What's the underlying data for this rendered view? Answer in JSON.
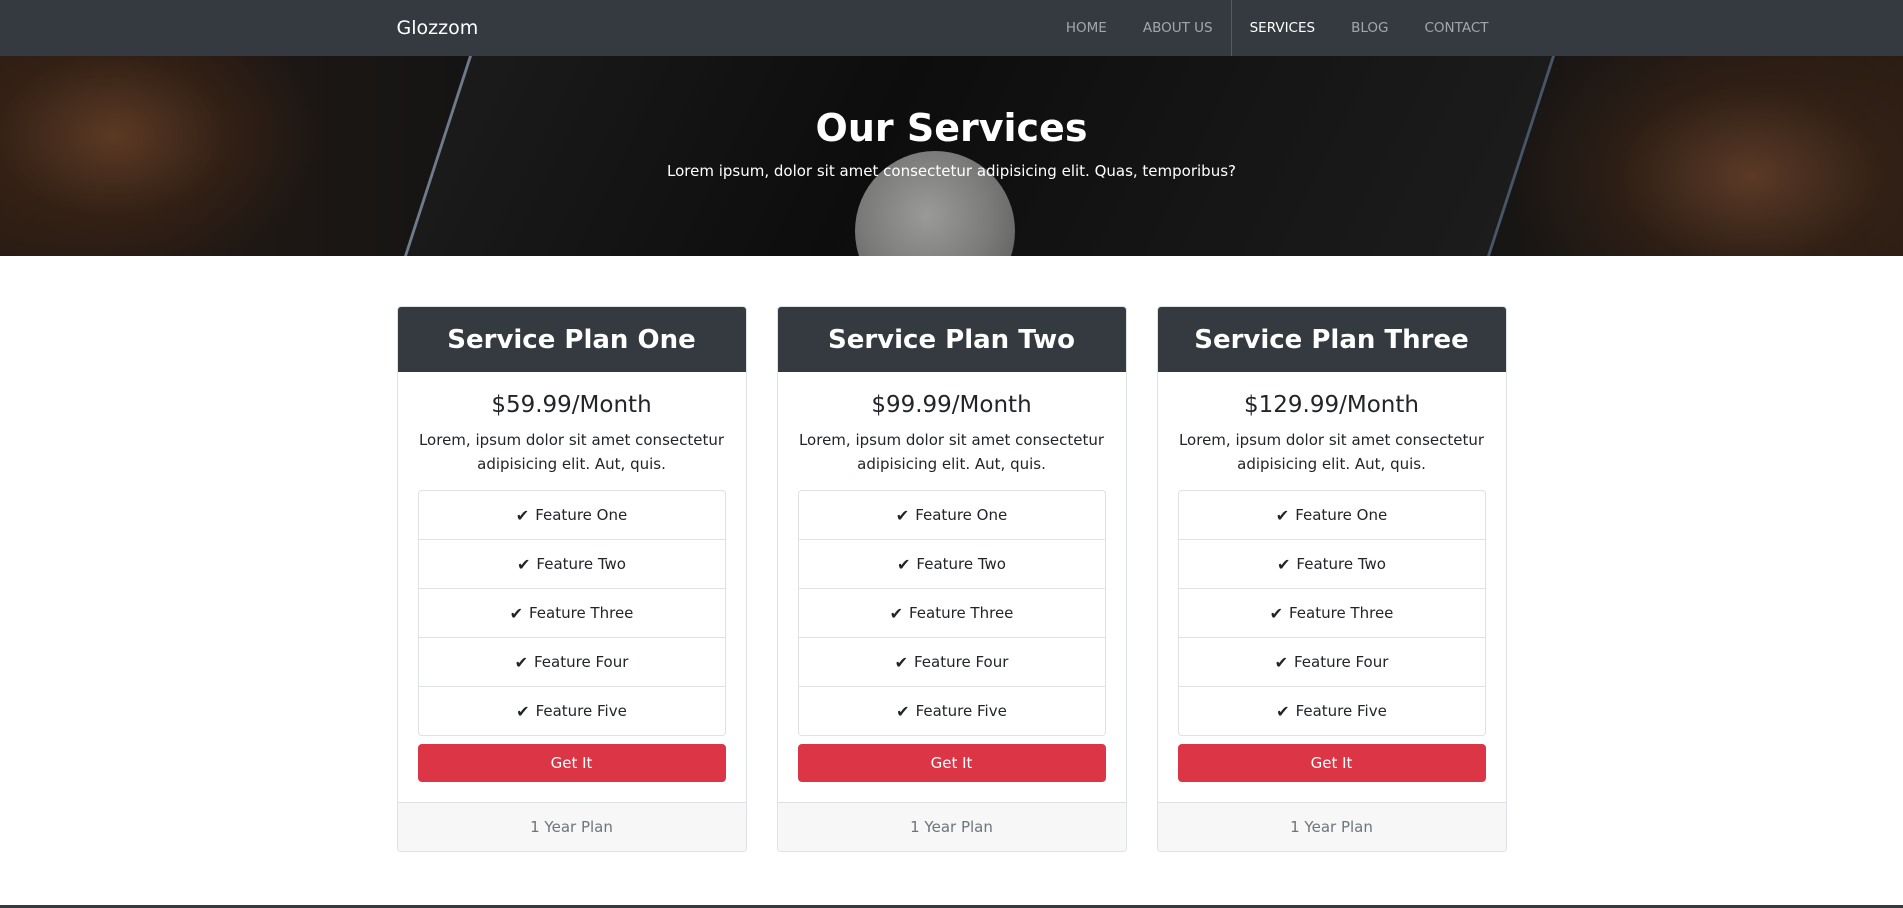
{
  "nav": {
    "brand": "Glozzom",
    "links": [
      "HOME",
      "ABOUT US",
      "SERVICES",
      "BLOG",
      "CONTACT"
    ]
  },
  "hero": {
    "title": "Our Services",
    "subtitle": "Lorem ipsum, dolor sit amet consectetur adipisicing elit. Quas, temporibus?"
  },
  "plans": [
    {
      "name": "Service Plan One",
      "price": "$59.99/Month",
      "description": "Lorem, ipsum dolor sit amet consectetur adipisicing elit. Aut, quis.",
      "features": [
        "Feature One",
        "Feature Two",
        "Feature Three",
        "Feature Four",
        "Feature Five"
      ],
      "button": "Get It",
      "footer": "1 Year Plan"
    },
    {
      "name": "Service Plan Two",
      "price": "$99.99/Month",
      "description": "Lorem, ipsum dolor sit amet consectetur adipisicing elit. Aut, quis.",
      "features": [
        "Feature One",
        "Feature Two",
        "Feature Three",
        "Feature Four",
        "Feature Five"
      ],
      "button": "Get It",
      "footer": "1 Year Plan"
    },
    {
      "name": "Service Plan Three",
      "price": "$129.99/Month",
      "description": "Lorem, ipsum dolor sit amet consectetur adipisicing elit. Aut, quis.",
      "features": [
        "Feature One",
        "Feature Two",
        "Feature Three",
        "Feature Four",
        "Feature Five"
      ],
      "button": "Get It",
      "footer": "1 Year Plan"
    }
  ],
  "icons": {
    "feature": "check-icon"
  },
  "colors": {
    "navbar": "#343a40",
    "button": "#dc3545",
    "footer_bg": "#f7f7f7"
  }
}
